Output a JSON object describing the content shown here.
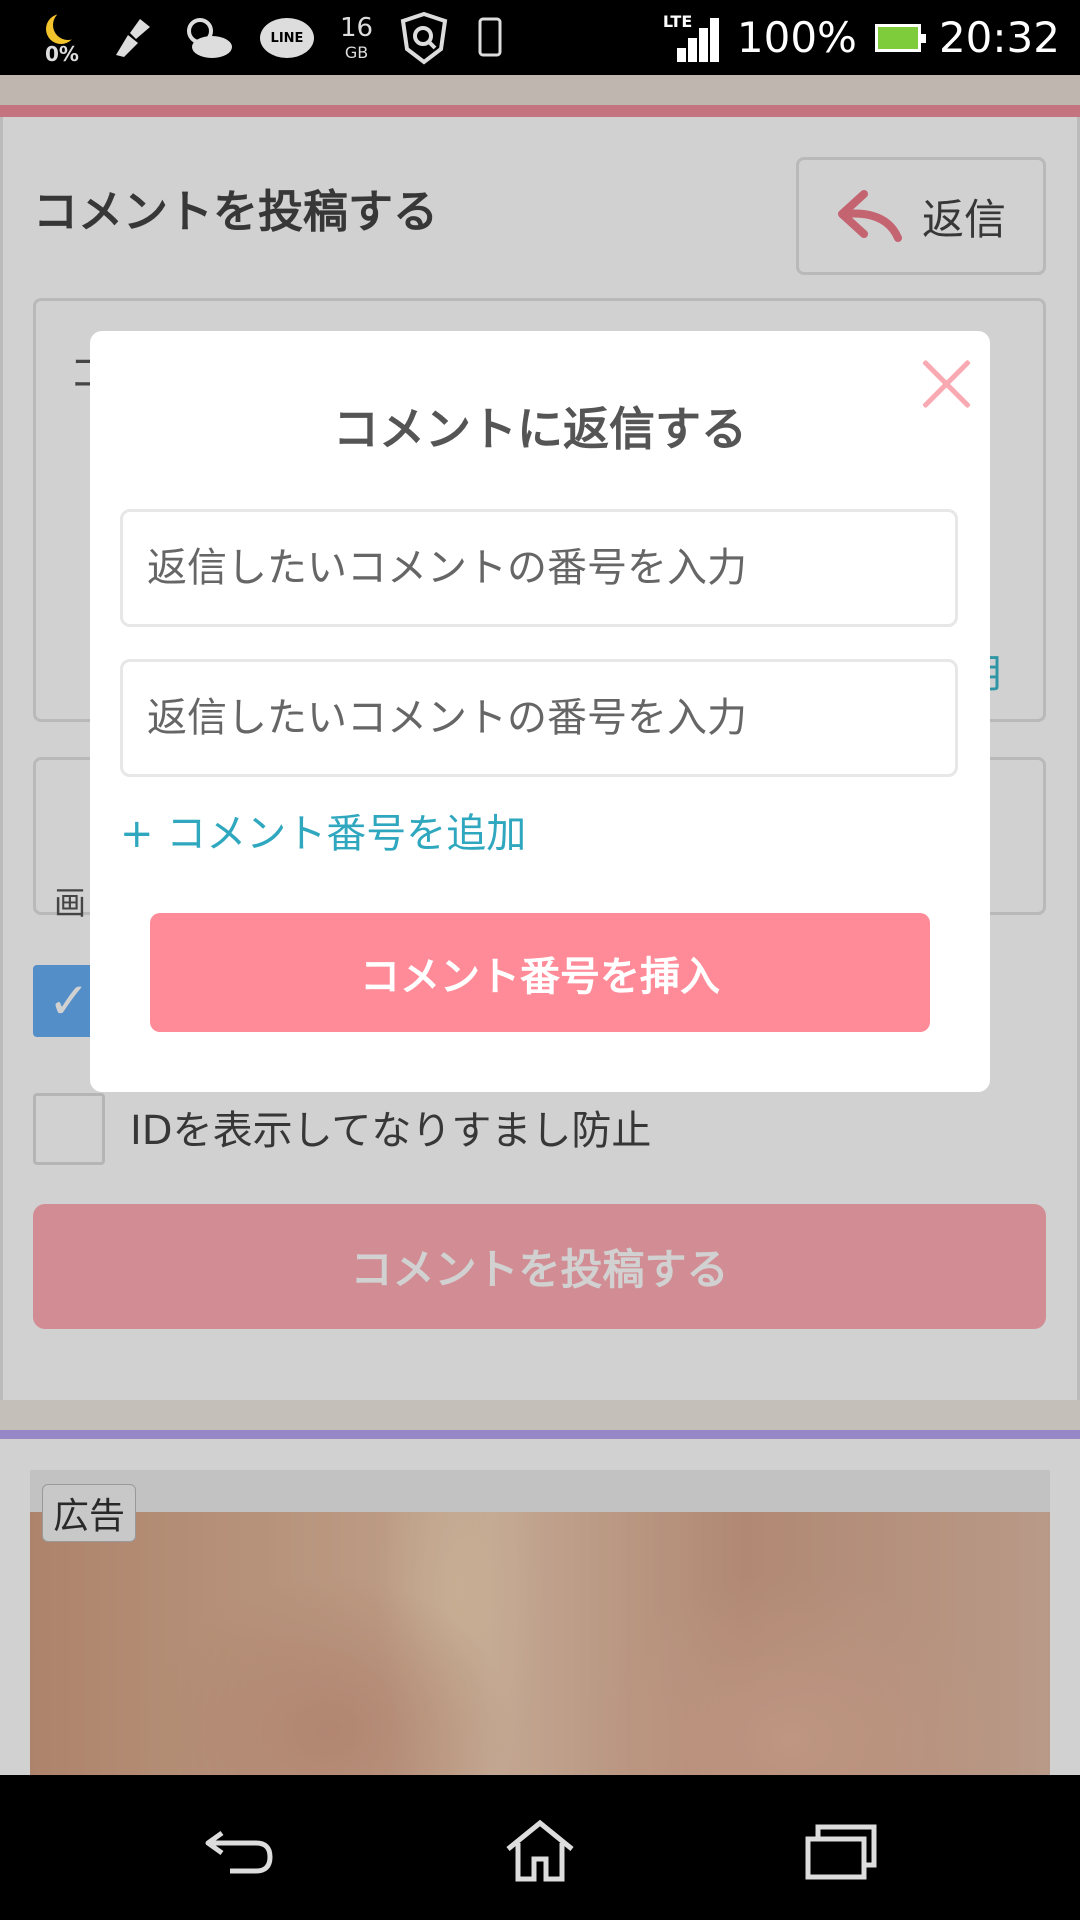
{
  "status_bar": {
    "night_percent": "0%",
    "storage_value": "16",
    "storage_unit": "GB",
    "line_label": "LINE",
    "network": "LTE",
    "battery": "100%",
    "time": "20:32"
  },
  "page": {
    "title": "コメントを投稿する",
    "reply_button_label": "返信",
    "textarea_fragment": "コ",
    "textarea_link_fragment": "用",
    "image_fragment": "画",
    "id_checkbox_label": "IDを表示してなりすまし防止",
    "submit_label": "コメントを投稿する",
    "ad_label": "広告"
  },
  "modal": {
    "title": "コメントに返信する",
    "inputs": [
      {
        "placeholder": "返信したいコメントの番号を入力"
      },
      {
        "placeholder": "返信したいコメントの番号を入力"
      }
    ],
    "add_link": "+ コメント番号を追加",
    "insert_button": "コメント番号を挿入"
  },
  "colors": {
    "accent_pink": "#ff8b98",
    "link_teal": "#2fa8bf",
    "checkbox_blue": "#66aef5"
  },
  "icons": [
    "moon-icon",
    "broom-icon",
    "weather-icon",
    "line-icon",
    "shield-icon",
    "phone-icon",
    "signal-icon",
    "battery-icon",
    "reply-arrow-icon",
    "close-icon",
    "back-icon",
    "home-icon",
    "recent-apps-icon"
  ]
}
